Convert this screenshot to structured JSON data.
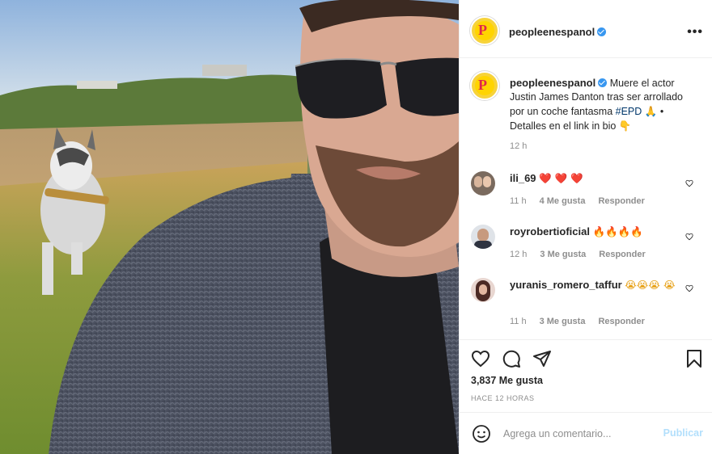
{
  "post": {
    "username": "peopleenespanol",
    "verified": true,
    "more_icon": "more-horizontal-icon",
    "caption": {
      "text_before": "Muere el actor Justin James Danton tras ser arrollado por un coche fantasma ",
      "hashtag": "#EPD",
      "emoji_pray": "🙏",
      "text_after": " • Detalles en el link in bio ",
      "emoji_point": "👇",
      "time": "12 h"
    },
    "comments": [
      {
        "username": "ili_69",
        "text": "❤️ ❤️ ❤️",
        "time": "11 h",
        "likes": "4 Me gusta",
        "reply": "Responder"
      },
      {
        "username": "royrobertioficial",
        "text": "🔥🔥🔥🔥",
        "time": "12 h",
        "likes": "3 Me gusta",
        "reply": "Responder"
      },
      {
        "username": "yuranis_romero_taffur",
        "text": "😭😭😭 😭",
        "time": "11 h",
        "likes": "3 Me gusta",
        "reply": "Responder"
      }
    ],
    "likes_count": "3,837 Me gusta",
    "posted_ago": "HACE 12 HORAS",
    "add_comment": {
      "placeholder": "Agrega un comentario...",
      "publish_label": "Publicar"
    },
    "colors": {
      "accent": "#3897f0",
      "publish_disabled": "#b2dffc",
      "brand_yellow": "#ffd400",
      "brand_pink": "#e0264b"
    }
  }
}
